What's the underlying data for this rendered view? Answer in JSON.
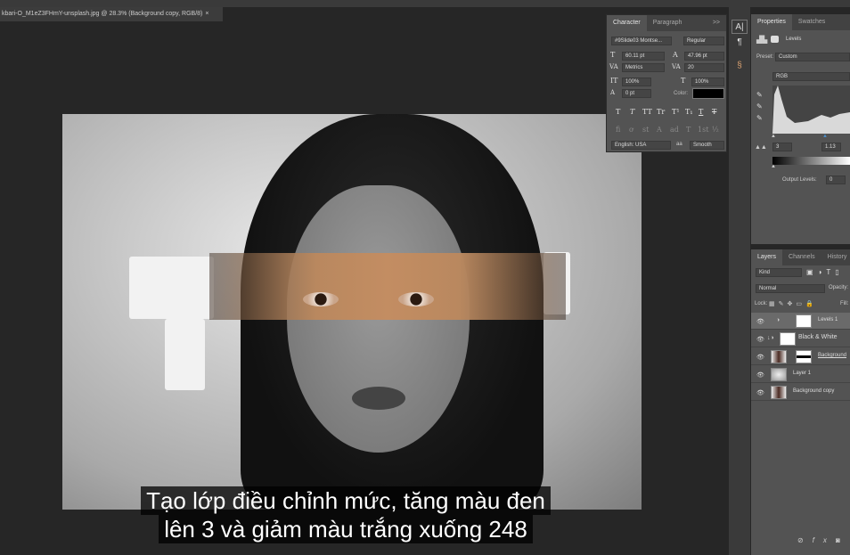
{
  "document": {
    "tab_title": "kbari-O_M1eZ3FHmY-unsplash.jpg @ 28.3% (Background copy, RGB/8)",
    "close": "×"
  },
  "character": {
    "tabs": [
      "Character",
      "Paragraph"
    ],
    "menu": ">>",
    "font_family": "#9Slide03 Montse...",
    "font_style": "Regular",
    "size": "60.11 pt",
    "leading": "47.96 pt",
    "kerning": "Metrics",
    "tracking": "20",
    "vscale": "100%",
    "hscale": "100%",
    "baseline": "0 pt",
    "color_label": "Color:",
    "style_buttons": [
      "T",
      "T",
      "TT",
      "Tr",
      "T¹",
      "T₁",
      "T",
      "T"
    ],
    "opentype": [
      "fi",
      "ơ",
      "st",
      "A",
      "ad",
      "T",
      "1st",
      "½"
    ],
    "language": "English: USA",
    "aa_icon": "aa",
    "antialias": "Smooth"
  },
  "properties": {
    "tabs": [
      "Properties",
      "Swatches"
    ],
    "title": "Levels",
    "preset_label": "Preset:",
    "preset": "Custom",
    "channel": "RGB",
    "input_black": "3",
    "input_mid": "1.13",
    "output_label": "Output Levels:",
    "output_black": "0"
  },
  "layers": {
    "tabs": [
      "Layers",
      "Channels",
      "History"
    ],
    "filter": "Kind",
    "blend": "Normal",
    "opacity_label": "Opacity:",
    "lock_label": "Lock:",
    "fill_label": "Fill:",
    "items": [
      {
        "name": "Levels 1",
        "selected": true
      },
      {
        "name": "Black & White",
        "selected": false
      },
      {
        "name": "Background",
        "selected": false
      },
      {
        "name": "Layer 1",
        "selected": false
      },
      {
        "name": "Background copy",
        "selected": false
      }
    ],
    "footer_icons": [
      "link",
      "fx",
      "mask"
    ]
  },
  "subtitle": [
    "Tạo lớp điều chỉnh mức, tăng màu đen",
    "lên 3 và giảm màu trắng xuống 248"
  ]
}
